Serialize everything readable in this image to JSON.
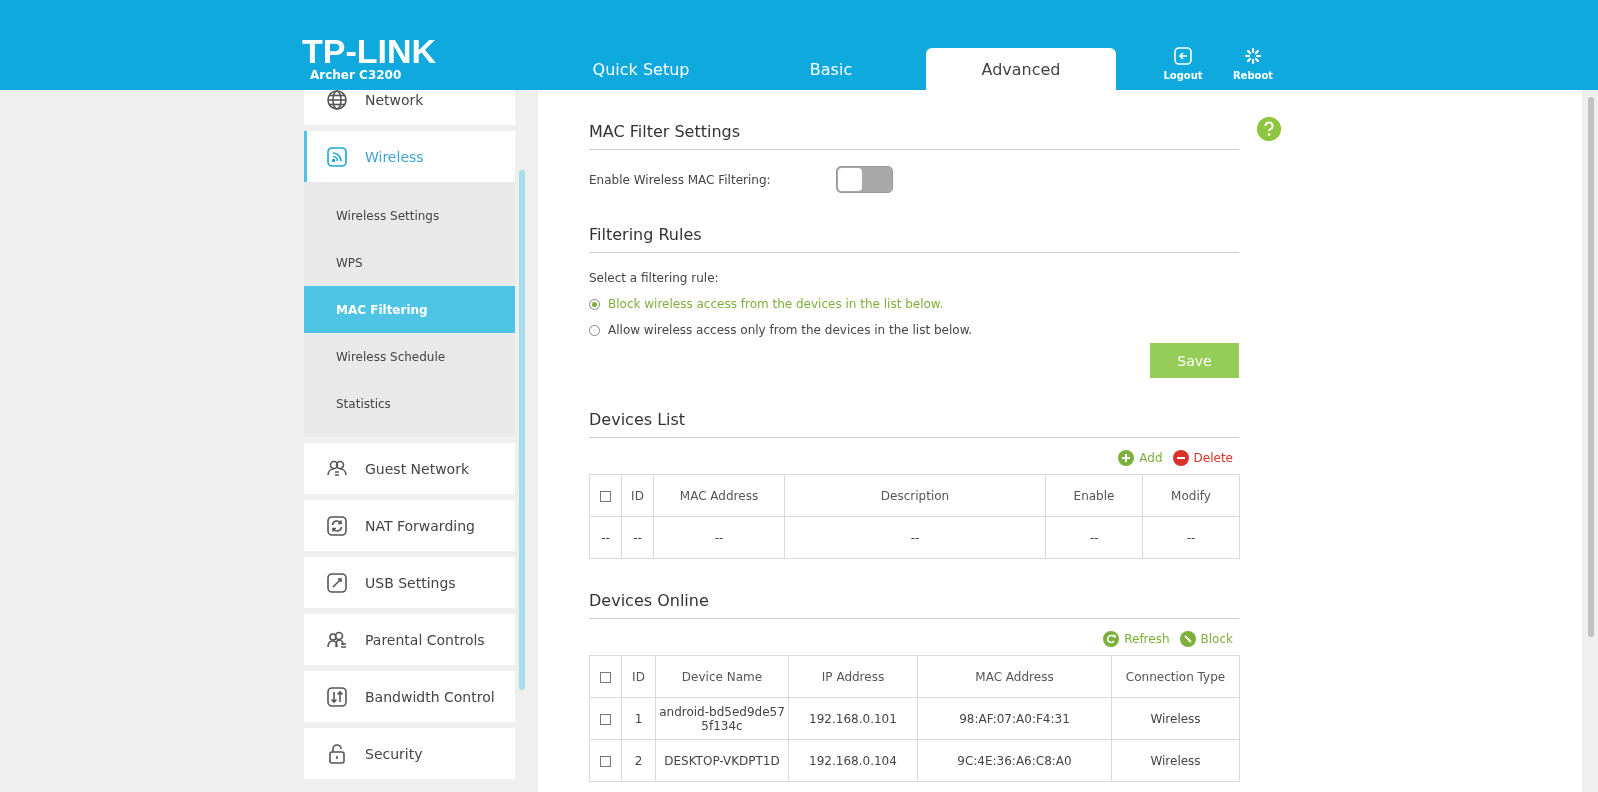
{
  "header": {
    "logo": "TP-LINK",
    "model": "Archer C3200",
    "tabs": [
      {
        "label": "Quick Setup",
        "selected": false
      },
      {
        "label": "Basic",
        "selected": false
      },
      {
        "label": "Advanced",
        "selected": true
      }
    ],
    "actions": [
      {
        "label": "Logout",
        "kind": "logout"
      },
      {
        "label": "Reboot",
        "kind": "reboot"
      }
    ]
  },
  "sidebar": {
    "items": [
      {
        "label": "Network",
        "kind": "globe",
        "selected": false
      },
      {
        "label": "Wireless",
        "kind": "wireless",
        "selected": true,
        "expanded": true,
        "children": [
          {
            "label": "Wireless Settings",
            "selected": false
          },
          {
            "label": "WPS",
            "selected": false
          },
          {
            "label": "MAC Filtering",
            "selected": true
          },
          {
            "label": "Wireless Schedule",
            "selected": false
          },
          {
            "label": "Statistics",
            "selected": false
          }
        ]
      },
      {
        "label": "Guest Network",
        "kind": "guest",
        "selected": false
      },
      {
        "label": "NAT Forwarding",
        "kind": "nat",
        "selected": false
      },
      {
        "label": "USB Settings",
        "kind": "usb",
        "selected": false
      },
      {
        "label": "Parental Controls",
        "kind": "parental",
        "selected": false
      },
      {
        "label": "Bandwidth Control",
        "kind": "bandwidth",
        "selected": false
      },
      {
        "label": "Security",
        "kind": "lock",
        "selected": false
      }
    ]
  },
  "mac_filter": {
    "title": "MAC Filter Settings",
    "label": "Enable Wireless MAC Filtering:",
    "enabled": false
  },
  "filtering_rules": {
    "title": "Filtering Rules",
    "prompt": "Select a filtering rule:",
    "options": [
      {
        "label": "Block wireless access from the devices in the list below.",
        "selected": true
      },
      {
        "label": "Allow wireless access only from the devices in the list below.",
        "selected": false
      }
    ],
    "save": "Save"
  },
  "devices_list": {
    "title": "Devices List",
    "actions": [
      {
        "label": "Add",
        "kind": "add"
      },
      {
        "label": "Delete",
        "kind": "delete"
      }
    ],
    "header_checked": false,
    "columns": [
      "",
      "ID",
      "MAC Address",
      "Description",
      "Enable",
      "Modify"
    ],
    "rows": [
      {
        "cells": [
          "--",
          "--",
          "--",
          "--",
          "--",
          "--"
        ]
      }
    ]
  },
  "devices_online": {
    "title": "Devices Online",
    "actions": [
      {
        "label": "Refresh",
        "kind": "refresh"
      },
      {
        "label": "Block",
        "kind": "block"
      }
    ],
    "header_checked": false,
    "columns": [
      "ID",
      "Device Name",
      "IP Address",
      "MAC Address",
      "Connection Type"
    ],
    "rows": [
      {
        "checked": false,
        "cells": [
          "1",
          "android-bd5ed9de575f134c",
          "192.168.0.101",
          "98:AF:07:A0:F4:31",
          "Wireless"
        ]
      },
      {
        "checked": false,
        "cells": [
          "2",
          "DESKTOP-VKDPT1D",
          "192.168.0.104",
          "9C:4E:36:A6:C8:A0",
          "Wireless"
        ]
      }
    ]
  }
}
